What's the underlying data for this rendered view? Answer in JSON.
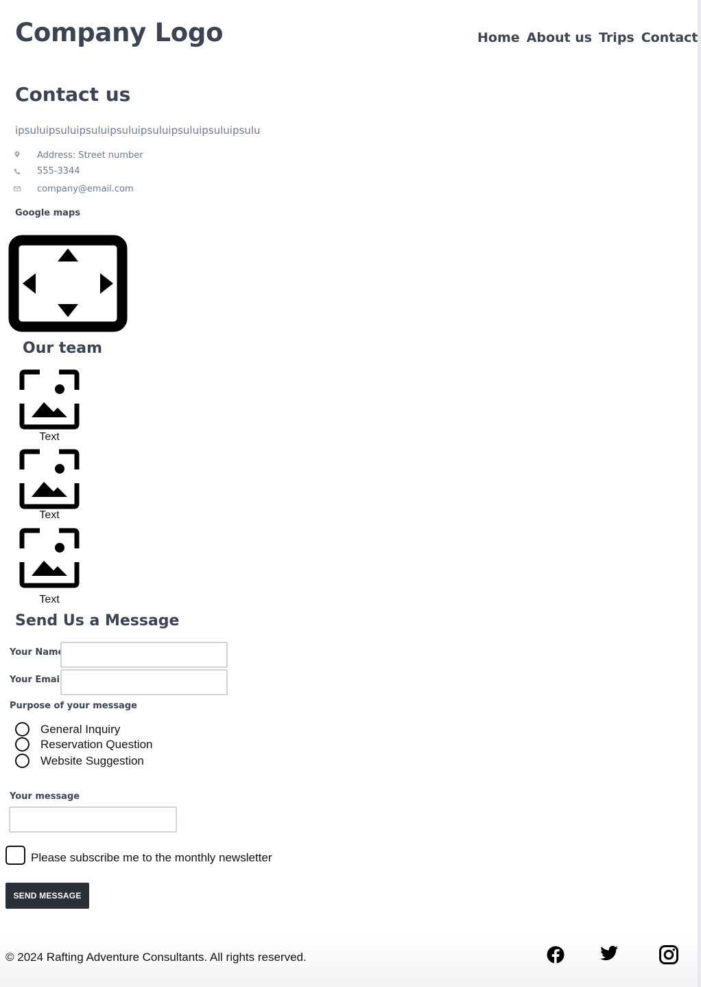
{
  "header": {
    "logo_text": "Company Logo",
    "nav": [
      "Home",
      "About us",
      "Trips",
      "Contact"
    ]
  },
  "contact": {
    "title": "Contact us",
    "intro": "ipsuluipsuluipsuluipsuluipsuluipsuluipsuluipsulu",
    "address": "Address: Street number",
    "phone": "555-3344",
    "email": "company@email.com",
    "maps_label": "Google maps"
  },
  "team": {
    "title": "Our team",
    "members": [
      {
        "caption": "Text"
      },
      {
        "caption": "Text"
      },
      {
        "caption": "Text"
      }
    ]
  },
  "form": {
    "title": "Send Us a Message",
    "name_label": "Your Name",
    "name_value": "",
    "email_label": "Your Email",
    "email_value": "",
    "purpose_label": "Purpose of your message",
    "purpose_options": [
      "General Inquiry",
      "Reservation Question",
      "Website Suggestion"
    ],
    "message_label": "Your message",
    "message_value": "",
    "newsletter_label": "Please subscribe me to the monthly newsletter",
    "newsletter_checked": false,
    "submit_label": "SEND MESSAGE"
  },
  "footer": {
    "copyright": "© 2024 Rafting Adventure Consultants. All rights reserved.",
    "social_icons": [
      "facebook-icon",
      "twitter-icon",
      "instagram-icon"
    ]
  },
  "colors": {
    "text": "#3a4452",
    "muted": "#6b7a8f",
    "button_bg": "#2a303a",
    "input_border": "#cfd5de"
  }
}
